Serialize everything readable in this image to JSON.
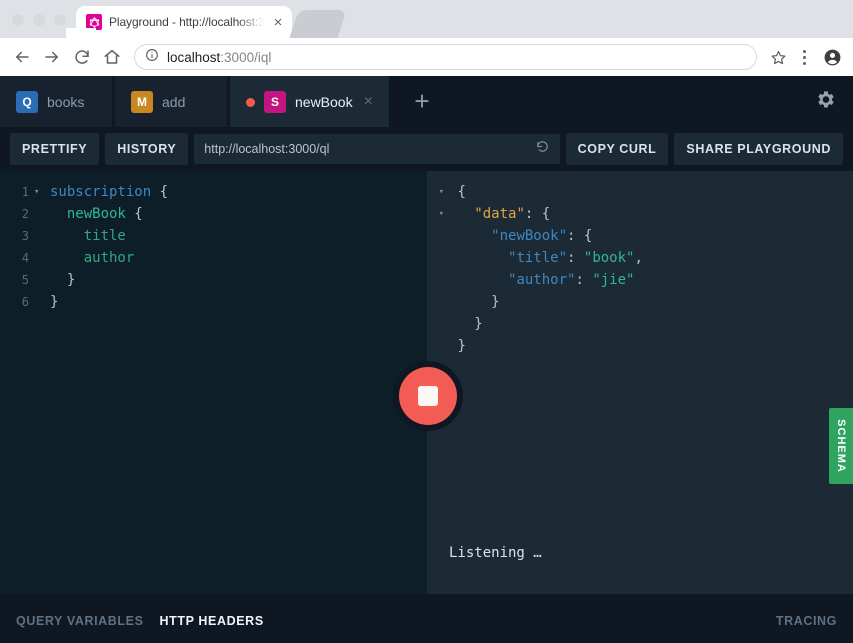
{
  "browser": {
    "tab": {
      "title": "Playground - http://localhost:3",
      "favicon": "graphql-favicon",
      "close": "×"
    },
    "nav": {
      "back": "back-arrow-icon",
      "forward": "forward-arrow-icon",
      "reload": "reload-icon",
      "home": "home-icon"
    },
    "omnibox": {
      "info_icon": "info-circle-icon",
      "url_host": "localhost",
      "url_rest": ":3000/iql",
      "star": "star-icon",
      "menu": "kebab-menu-icon"
    },
    "profile": "account-circle-icon"
  },
  "playground": {
    "tabs": [
      {
        "badge": "Q",
        "badge_color": "#2a6db5",
        "label": "books",
        "active": false,
        "dirty": false
      },
      {
        "badge": "M",
        "badge_color": "#c98721",
        "label": "add",
        "active": false,
        "dirty": false
      },
      {
        "badge": "S",
        "badge_color": "#c2157f",
        "label": "newBook",
        "active": true,
        "dirty": true,
        "close": "×"
      }
    ],
    "add_tab": "+",
    "settings_icon": "gear-icon",
    "toolbar": {
      "prettify": "PRETTIFY",
      "history": "HISTORY",
      "endpoint": "http://localhost:3000/ql",
      "reset_icon": "reset-circular-arrow-icon",
      "copy_curl": "COPY CURL",
      "share_playground": "SHARE PLAYGROUND"
    },
    "editor": {
      "lines": [
        {
          "no": "1",
          "fold": "▾",
          "indent": "",
          "segments": [
            {
              "t": "subscription",
              "c": "kw"
            },
            {
              "t": " {",
              "c": "pun"
            }
          ]
        },
        {
          "no": "2",
          "fold": "",
          "indent": "  ",
          "segments": [
            {
              "t": "newBook",
              "c": "fld"
            },
            {
              "t": " {",
              "c": "pun"
            }
          ]
        },
        {
          "no": "3",
          "fold": "",
          "indent": "    ",
          "segments": [
            {
              "t": "title",
              "c": "fld2"
            }
          ]
        },
        {
          "no": "4",
          "fold": "",
          "indent": "    ",
          "segments": [
            {
              "t": "author",
              "c": "fld2"
            }
          ]
        },
        {
          "no": "5",
          "fold": "",
          "indent": "  ",
          "segments": [
            {
              "t": "}",
              "c": "pun"
            }
          ]
        },
        {
          "no": "6",
          "fold": "",
          "indent": "",
          "segments": [
            {
              "t": "}",
              "c": "pun"
            }
          ]
        }
      ]
    },
    "response": {
      "lines": [
        {
          "fold": "▾",
          "indent": " ",
          "segments": [
            {
              "t": "{",
              "c": "jp"
            }
          ]
        },
        {
          "fold": "▾",
          "indent": "   ",
          "segments": [
            {
              "t": "\"data\"",
              "c": "jk-data"
            },
            {
              "t": ": {",
              "c": "jp"
            }
          ]
        },
        {
          "fold": "",
          "indent": "     ",
          "segments": [
            {
              "t": "\"newBook\"",
              "c": "jk"
            },
            {
              "t": ": {",
              "c": "jp"
            }
          ]
        },
        {
          "fold": "",
          "indent": "       ",
          "segments": [
            {
              "t": "\"title\"",
              "c": "jk"
            },
            {
              "t": ": ",
              "c": "jp"
            },
            {
              "t": "\"book\"",
              "c": "jv"
            },
            {
              "t": ",",
              "c": "jp"
            }
          ]
        },
        {
          "fold": "",
          "indent": "       ",
          "segments": [
            {
              "t": "\"author\"",
              "c": "jk"
            },
            {
              "t": ": ",
              "c": "jp"
            },
            {
              "t": "\"jie\"",
              "c": "jv"
            }
          ]
        },
        {
          "fold": "",
          "indent": "     ",
          "segments": [
            {
              "t": "}",
              "c": "jp"
            }
          ]
        },
        {
          "fold": "",
          "indent": "   ",
          "segments": [
            {
              "t": "}",
              "c": "jp"
            }
          ]
        },
        {
          "fold": "",
          "indent": " ",
          "segments": [
            {
              "t": "}",
              "c": "jp"
            }
          ]
        }
      ],
      "status": "Listening …"
    },
    "stop_button": {
      "icon": "stop-square-icon",
      "color": "#f25c54"
    },
    "schema_tab": {
      "label": "SCHEMA",
      "color": "#2fa360"
    },
    "footer": {
      "query_variables": "QUERY VARIABLES",
      "http_headers": "HTTP HEADERS",
      "tracing": "TRACING"
    }
  }
}
